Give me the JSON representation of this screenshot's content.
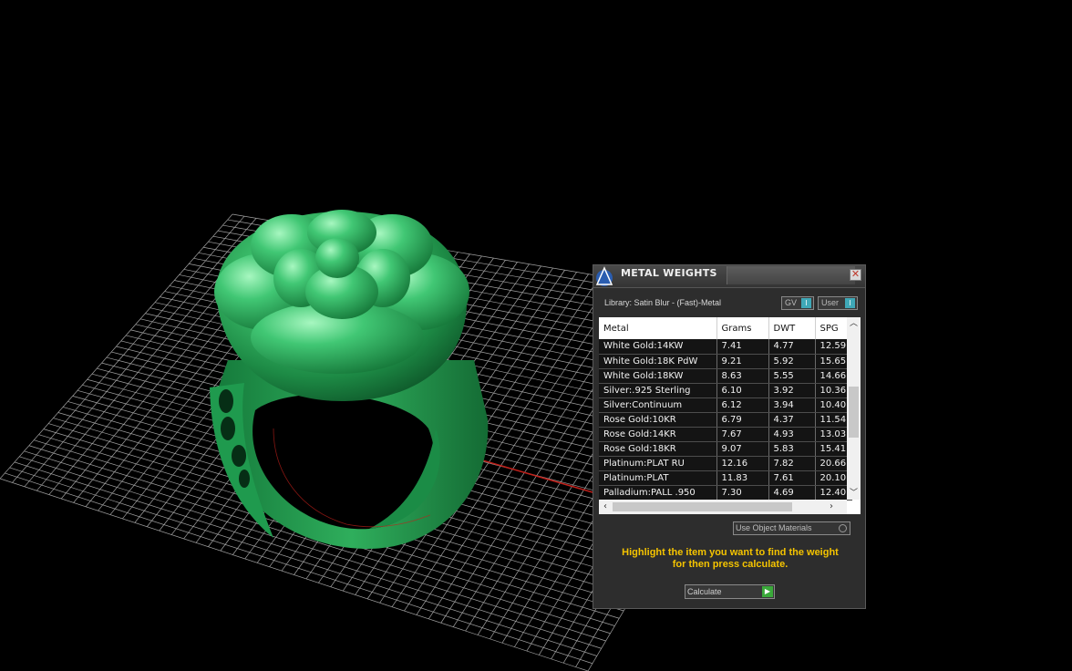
{
  "panel": {
    "title": "METAL WEIGHTS",
    "library_label": "Library: Satin Blur - (Fast)-Metal",
    "toggle_gv": "GV",
    "toggle_user": "User",
    "toggle_indicator": "I",
    "columns": [
      "Metal",
      "Grams",
      "DWT",
      "SPG"
    ],
    "rows": [
      [
        "White Gold:14KW",
        "7.41",
        "4.77",
        "12.59"
      ],
      [
        "White Gold:18K PdW",
        "9.21",
        "5.92",
        "15.65"
      ],
      [
        "White Gold:18KW",
        "8.63",
        "5.55",
        "14.66"
      ],
      [
        "Silver:.925 Sterling",
        "6.10",
        "3.92",
        "10.36"
      ],
      [
        "Silver:Continuum",
        "6.12",
        "3.94",
        "10.40"
      ],
      [
        "Rose Gold:10KR",
        "6.79",
        "4.37",
        "11.54"
      ],
      [
        "Rose Gold:14KR",
        "7.67",
        "4.93",
        "13.03"
      ],
      [
        "Rose Gold:18KR",
        "9.07",
        "5.83",
        "15.41"
      ],
      [
        "Platinum:PLAT RU",
        "12.16",
        "7.82",
        "20.66"
      ],
      [
        "Platinum:PLAT",
        "11.83",
        "7.61",
        "20.10"
      ],
      [
        "Palladium:PALL .950",
        "7.30",
        "4.69",
        "12.40"
      ]
    ],
    "use_object_materials": "Use Object Materials",
    "hint_line1": "Highlight the item you want to find the weight",
    "hint_line2": "for then press calculate.",
    "calculate_label": "Calculate",
    "close_symbol": "✕"
  },
  "colors": {
    "ring": "#2e9e52",
    "grid": "#bfbfbf",
    "hint": "#f5c400",
    "accent_toggle": "#3fa8b7",
    "calc_button": "#3aa93a"
  },
  "icons": [
    "app-logo-icon",
    "close-icon",
    "scroll-up-icon",
    "scroll-down-icon",
    "scroll-left-icon",
    "scroll-right-icon",
    "play-icon"
  ]
}
